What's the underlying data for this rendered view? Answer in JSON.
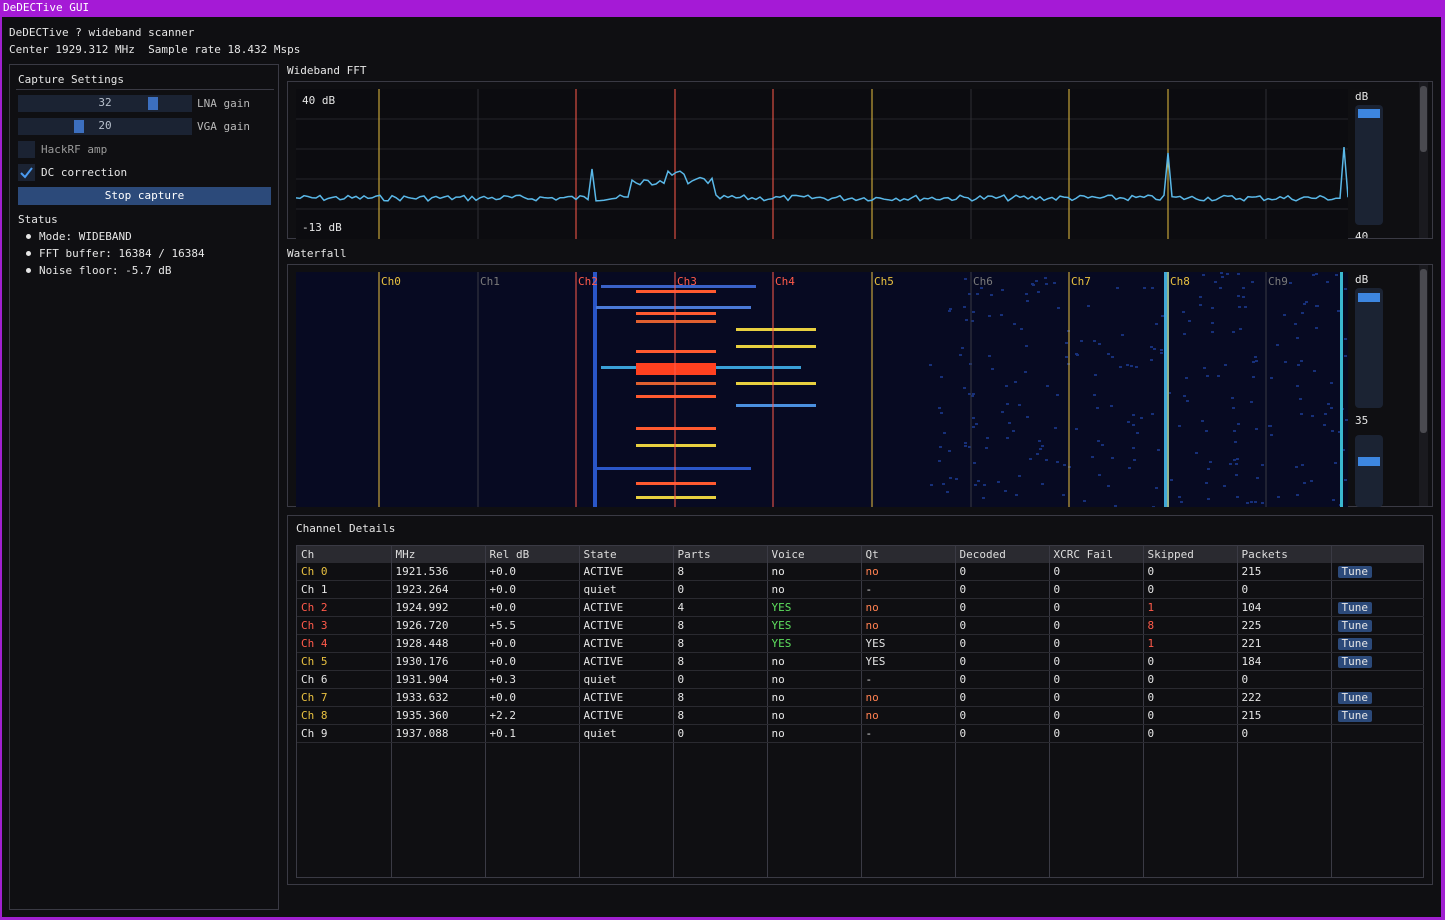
{
  "window": {
    "title": "DeDECTive GUI"
  },
  "header": {
    "line1": "DeDECTive ? wideband scanner",
    "line2": "Center 1929.312 MHz  Sample rate 18.432 Msps"
  },
  "capture": {
    "title": "Capture Settings",
    "lna": {
      "value": "32",
      "label": "LNA gain",
      "fraction": 0.79
    },
    "vga": {
      "value": "20",
      "label": "VGA gain",
      "fraction": 0.34
    },
    "hackrf_amp": {
      "label": "HackRF amp",
      "checked": false
    },
    "dc_correction": {
      "label": "DC correction",
      "checked": true
    },
    "stop_button": "Stop capture"
  },
  "status": {
    "title": "Status",
    "items": [
      "Mode: WIDEBAND",
      "FFT buffer: 16384 / 16384",
      "Noise floor: -5.7 dB"
    ]
  },
  "fft": {
    "title": "Wideband FFT",
    "top_label": "40 dB",
    "bottom_label": "-13 dB",
    "db_label": "dB",
    "slider_value": "40"
  },
  "waterfall": {
    "title": "Waterfall",
    "db_label": "dB",
    "slider_value": "35",
    "channels": [
      "Ch0",
      "Ch1",
      "Ch2",
      "Ch3",
      "Ch4",
      "Ch5",
      "Ch6",
      "Ch7",
      "Ch8",
      "Ch9"
    ]
  },
  "colors": {
    "active_channel": "#e8c040",
    "hot_channel": "#ff5a4a",
    "quiet_channel": "#7a7a7a",
    "fft_trace": "#5ab8e8",
    "accent": "#2c4a7a"
  },
  "details": {
    "title": "Channel Details",
    "columns": [
      "Ch",
      "MHz",
      "Rel dB",
      "State",
      "Parts",
      "Voice",
      "Qt",
      "Decoded",
      "XCRC Fail",
      "Skipped",
      "Packets",
      ""
    ],
    "rows": [
      {
        "ch": "Ch 0",
        "mhz": "1921.536",
        "rel": "+0.0",
        "state": "ACTIVE",
        "parts": "8",
        "voice": "no",
        "qt": "no",
        "decoded": "0",
        "xcrc": "0",
        "skipped": "0",
        "packets": "215",
        "tune": "Tune",
        "color": "active"
      },
      {
        "ch": "Ch 1",
        "mhz": "1923.264",
        "rel": "+0.0",
        "state": "quiet",
        "parts": "0",
        "voice": "no",
        "qt": "-",
        "decoded": "0",
        "xcrc": "0",
        "skipped": "0",
        "packets": "0",
        "tune": "",
        "color": "quiet"
      },
      {
        "ch": "Ch 2",
        "mhz": "1924.992",
        "rel": "+0.0",
        "state": "ACTIVE",
        "parts": "4",
        "voice": "YES",
        "qt": "no",
        "decoded": "0",
        "xcrc": "0",
        "skipped": "1",
        "packets": "104",
        "tune": "Tune",
        "color": "hot"
      },
      {
        "ch": "Ch 3",
        "mhz": "1926.720",
        "rel": "+5.5",
        "state": "ACTIVE",
        "parts": "8",
        "voice": "YES",
        "qt": "no",
        "decoded": "0",
        "xcrc": "0",
        "skipped": "8",
        "packets": "225",
        "tune": "Tune",
        "color": "hot"
      },
      {
        "ch": "Ch 4",
        "mhz": "1928.448",
        "rel": "+0.0",
        "state": "ACTIVE",
        "parts": "8",
        "voice": "YES",
        "qt": "YES",
        "decoded": "0",
        "xcrc": "0",
        "skipped": "1",
        "packets": "221",
        "tune": "Tune",
        "color": "hot"
      },
      {
        "ch": "Ch 5",
        "mhz": "1930.176",
        "rel": "+0.0",
        "state": "ACTIVE",
        "parts": "8",
        "voice": "no",
        "qt": "YES",
        "decoded": "0",
        "xcrc": "0",
        "skipped": "0",
        "packets": "184",
        "tune": "Tune",
        "color": "active"
      },
      {
        "ch": "Ch 6",
        "mhz": "1931.904",
        "rel": "+0.3",
        "state": "quiet",
        "parts": "0",
        "voice": "no",
        "qt": "-",
        "decoded": "0",
        "xcrc": "0",
        "skipped": "0",
        "packets": "0",
        "tune": "",
        "color": "quiet"
      },
      {
        "ch": "Ch 7",
        "mhz": "1933.632",
        "rel": "+0.0",
        "state": "ACTIVE",
        "parts": "8",
        "voice": "no",
        "qt": "no",
        "decoded": "0",
        "xcrc": "0",
        "skipped": "0",
        "packets": "222",
        "tune": "Tune",
        "color": "active"
      },
      {
        "ch": "Ch 8",
        "mhz": "1935.360",
        "rel": "+2.2",
        "state": "ACTIVE",
        "parts": "8",
        "voice": "no",
        "qt": "no",
        "decoded": "0",
        "xcrc": "0",
        "skipped": "0",
        "packets": "215",
        "tune": "Tune",
        "color": "active"
      },
      {
        "ch": "Ch 9",
        "mhz": "1937.088",
        "rel": "+0.1",
        "state": "quiet",
        "parts": "0",
        "voice": "no",
        "qt": "-",
        "decoded": "0",
        "xcrc": "0",
        "skipped": "0",
        "packets": "0",
        "tune": "",
        "color": "quiet"
      }
    ]
  }
}
